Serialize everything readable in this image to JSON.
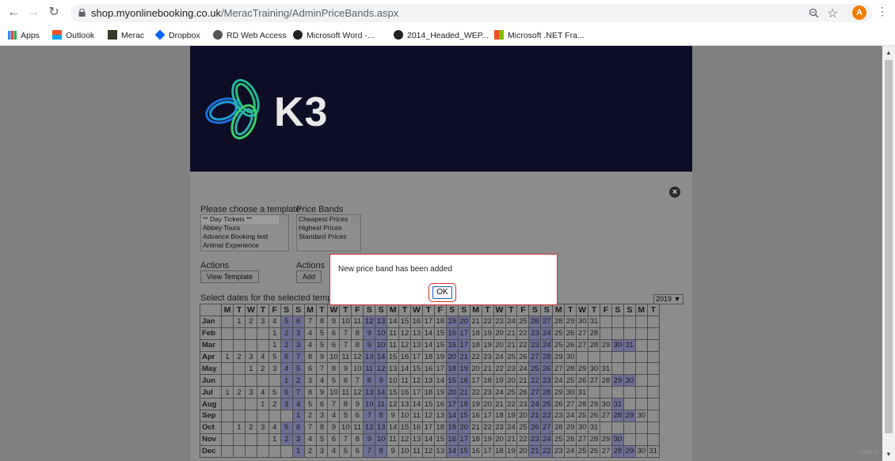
{
  "browser": {
    "url_host": "shop.myonlinebooking.co.uk",
    "url_path": "/MeracTraining/AdminPriceBands.aspx",
    "avatar_letter": "A",
    "bookmarks": [
      "Apps",
      "Outlook",
      "Merac",
      "Dropbox",
      "RD Web Access",
      "Microsoft Word -...",
      "2014_Headed_WEP...",
      "Microsoft .NET Fra..."
    ]
  },
  "banner": {
    "logo_text": "K3"
  },
  "form": {
    "template_label": "Please choose a template",
    "templates": [
      "** Day Tickets **",
      "Abbey Tours",
      "Advance Booking test",
      "Animal Experience"
    ],
    "price_bands_label": "Price Bands",
    "price_bands": [
      "Cheapest Prices",
      "Highest Prices",
      "Standard Prices"
    ],
    "actions_label_1": "Actions",
    "actions_label_2": "Actions",
    "view_template_button": "View Template",
    "add_button": "Add",
    "select_dates_label": "Select dates for the selected templa",
    "year": "2019"
  },
  "calendar": {
    "weekday_headers": [
      "M",
      "T",
      "W",
      "T",
      "F",
      "S",
      "S",
      "M",
      "T",
      "W",
      "T",
      "F",
      "S",
      "S",
      "M",
      "T",
      "W",
      "T",
      "F",
      "S",
      "S",
      "M",
      "T",
      "W",
      "T",
      "F",
      "S",
      "S",
      "M",
      "T",
      "W",
      "T",
      "F",
      "S",
      "S",
      "M",
      "T"
    ],
    "months": [
      {
        "name": "Jan",
        "offset": 1,
        "days": 31
      },
      {
        "name": "Feb",
        "offset": 4,
        "days": 28
      },
      {
        "name": "Mar",
        "offset": 4,
        "days": 31
      },
      {
        "name": "Apr",
        "offset": 0,
        "days": 30
      },
      {
        "name": "May",
        "offset": 2,
        "days": 31
      },
      {
        "name": "Jun",
        "offset": 5,
        "days": 30
      },
      {
        "name": "Jul",
        "offset": 0,
        "days": 31
      },
      {
        "name": "Aug",
        "offset": 3,
        "days": 31
      },
      {
        "name": "Sep",
        "offset": 6,
        "days": 30
      },
      {
        "name": "Oct",
        "offset": 1,
        "days": 31
      },
      {
        "name": "Nov",
        "offset": 4,
        "days": 30
      },
      {
        "name": "Dec",
        "offset": 6,
        "days": 31
      }
    ]
  },
  "dialog": {
    "message": "New price band has been added",
    "ok_label": "OK"
  },
  "footer": {
    "version": "v2019.2"
  },
  "colors": {
    "weekend_cell": "#6e6e96",
    "banner_bg": "#0d0d26",
    "dialog_border": "#d0312d"
  }
}
